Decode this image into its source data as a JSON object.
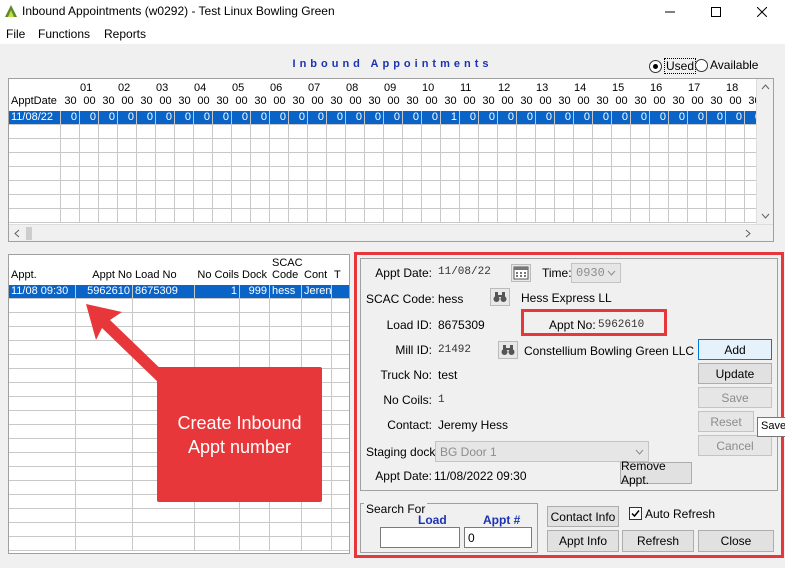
{
  "window": {
    "title": "Inbound Appointments (w0292) - Test Linux Bowling Green"
  },
  "menu": [
    "File",
    "Functions",
    "Reports"
  ],
  "grid": {
    "title": "Inbound Appointments",
    "view_options": [
      {
        "label": "Used",
        "selected": true
      },
      {
        "label": "Available",
        "selected": false
      }
    ],
    "row_header": "ApptDate",
    "hour_labels": [
      "01",
      "02",
      "03",
      "04",
      "05",
      "06",
      "07",
      "08",
      "09",
      "10",
      "11",
      "12",
      "13",
      "14",
      "15",
      "16",
      "17",
      "18"
    ],
    "columns": [
      "30",
      "00",
      "30",
      "00",
      "30",
      "00",
      "30",
      "00",
      "30",
      "00",
      "30",
      "00",
      "30",
      "00",
      "30",
      "00",
      "30",
      "00",
      "30",
      "00",
      "30",
      "00",
      "30",
      "00",
      "30",
      "00",
      "30",
      "00",
      "30",
      "00",
      "30",
      "00",
      "30",
      "00",
      "30",
      "00",
      "30",
      "00",
      "3"
    ],
    "rows": [
      {
        "date": "11/08/22",
        "values": [
          "0",
          "0",
          "0",
          "0",
          "0",
          "0",
          "0",
          "0",
          "0",
          "0",
          "0",
          "0",
          "0",
          "0",
          "0",
          "0",
          "0",
          "0",
          "0",
          "0",
          "1",
          "0",
          "0",
          "0",
          "0",
          "0",
          "0",
          "0",
          "0",
          "0",
          "0",
          "0",
          "0",
          "0",
          "0",
          "0",
          "0",
          "0",
          "0"
        ]
      }
    ]
  },
  "list": {
    "headers": [
      "Appt.",
      "Appt No",
      "Load No",
      "No Coils",
      "Dock",
      "SCAC Code",
      "Cont",
      "T"
    ],
    "rows": [
      {
        "appt": "11/08 09:30",
        "appt_no": "5962610",
        "load_no": "8675309",
        "coils": "1",
        "dock": "999",
        "scac": "hess",
        "cont": "Jeren"
      }
    ]
  },
  "details": {
    "appt_date_label": "Appt Date:",
    "appt_date": "11/08/22",
    "time_label": "Time:",
    "time": "0930",
    "scac_label": "SCAC Code:",
    "scac": "hess",
    "scac_name": "Hess Express LL",
    "load_label": "Load ID:",
    "load": "8675309",
    "apptno_label": "Appt No:",
    "apptno": "5962610",
    "mill_label": "Mill ID:",
    "mill": "21492",
    "mill_name": "Constellium Bowling Green LLC",
    "truck_label": "Truck No:",
    "truck": "test",
    "coils_label": "No Coils:",
    "coils": "1",
    "contact_label": "Contact:",
    "contact": "Jeremy Hess",
    "staging_label": "Staging dock:",
    "staging": "BG Door 1",
    "appt_dt_label": "Appt Date:",
    "appt_dt": "11/08/2022 09:30",
    "remove_btn": "Remove Appt."
  },
  "side_buttons": {
    "add": "Add",
    "update": "Update",
    "save": "Save",
    "reset": "Reset",
    "cancel": "Cancel"
  },
  "tooltip": "Save",
  "search": {
    "legend": "Search For",
    "load_label": "Load",
    "appt_label": "Appt #",
    "load_value": "",
    "appt_value": "0"
  },
  "bottom_buttons": {
    "contact_info": "Contact Info",
    "appt_info": "Appt Info",
    "refresh": "Refresh",
    "close": "Close",
    "auto_refresh": "Auto Refresh"
  },
  "annotation": {
    "text": "Create Inbound Appt number"
  },
  "colors": {
    "selection": "#0a64c8",
    "annotation": "#e8373b",
    "grid_title": "#1a33b3"
  }
}
